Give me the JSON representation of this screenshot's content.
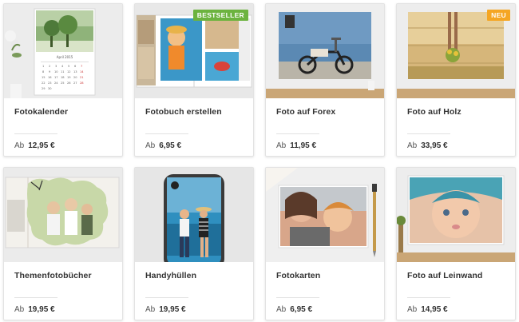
{
  "products": [
    {
      "title": "Fotokalender",
      "ab": "Ab",
      "price": "12,95 €",
      "badge": "",
      "image": "wall-calendar-photo"
    },
    {
      "title": "Fotobuch erstellen",
      "ab": "Ab",
      "price": "6,95 €",
      "badge": "BESTSELLER",
      "image": "open-photobook"
    },
    {
      "title": "Foto auf Forex",
      "ab": "Ab",
      "price": "11,95 €",
      "badge": "",
      "image": "scooter-print"
    },
    {
      "title": "Foto auf Holz",
      "ab": "Ab",
      "price": "33,95 €",
      "badge": "NEU",
      "image": "wood-print-field"
    },
    {
      "title": "Themenfotobücher",
      "ab": "Ab",
      "price": "19,95 €",
      "badge": "",
      "image": "themed-photobook"
    },
    {
      "title": "Handyhüllen",
      "ab": "Ab",
      "price": "19,95 €",
      "badge": "",
      "image": "phone-case-beach"
    },
    {
      "title": "Fotokarten",
      "ab": "Ab",
      "price": "6,95 €",
      "badge": "",
      "image": "photo-card-mother-child"
    },
    {
      "title": "Foto auf Leinwand",
      "ab": "Ab",
      "price": "14,95 €",
      "badge": "",
      "image": "canvas-baby"
    }
  ],
  "calendar": {
    "month": "April 2015"
  },
  "colors": {
    "bestseller_badge": "#6cb33f",
    "neu_badge": "#f5a623"
  }
}
